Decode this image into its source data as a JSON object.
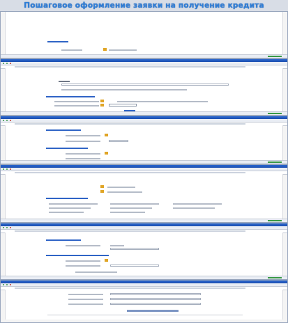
{
  "banner": {
    "text": "Пошаговое оформление заявки на получение кредита"
  },
  "windows": [
    {
      "id": "w1",
      "status": ""
    },
    {
      "id": "w2",
      "status": ""
    },
    {
      "id": "w3",
      "status": ""
    },
    {
      "id": "w4",
      "status": ""
    },
    {
      "id": "w5",
      "status": ""
    },
    {
      "id": "w6",
      "status": ""
    }
  ],
  "colors": {
    "titlebar": "#1c4fb0",
    "banner": "#2f7fd8",
    "link": "#2f64c6",
    "warning_icon": "#e0a526",
    "status_ok": "#3a9a46"
  }
}
